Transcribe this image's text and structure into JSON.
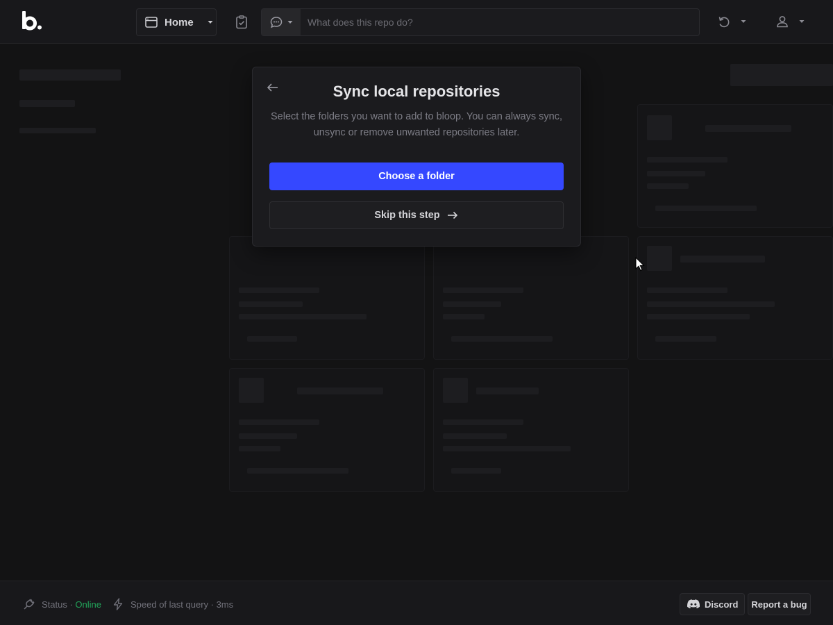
{
  "app": {
    "logo_text": "b."
  },
  "header": {
    "home_label": "Home",
    "search_placeholder": "What does this repo do?"
  },
  "modal": {
    "title": "Sync local repositories",
    "description_line1": "Select the folders you want to add to bloop. You can always sync,",
    "description_line2": "unsync or remove unwanted repositories later.",
    "primary_label": "Choose a folder",
    "secondary_label": "Skip this step"
  },
  "statusbar": {
    "status_label": "Status ·",
    "status_value": "Online",
    "speed_label": "Speed of last query · 3ms",
    "discord_label": "Discord",
    "bug_label": "Report a bug"
  },
  "colors": {
    "accent": "#3548ff",
    "online": "#22a55a",
    "background": "#131314",
    "panel": "#1b1b1e"
  },
  "icons": [
    "logo",
    "browser-window-icon",
    "caret-down-icon",
    "clipboard-check-icon",
    "chat-bubble-icon",
    "undo-icon",
    "user-icon",
    "arrow-left-icon",
    "arrow-right-icon",
    "plug-icon",
    "lightning-icon",
    "discord-icon"
  ]
}
